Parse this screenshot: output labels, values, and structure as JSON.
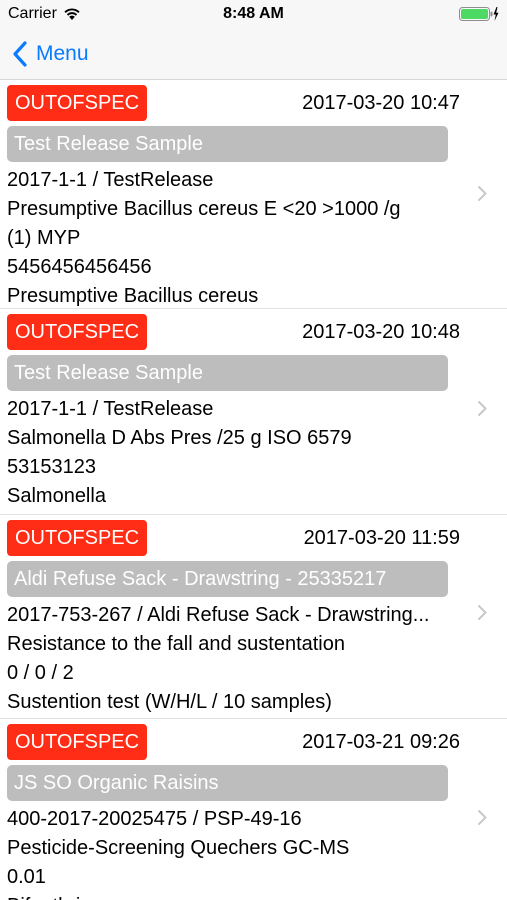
{
  "status_bar": {
    "carrier": "Carrier",
    "time": "8:48 AM"
  },
  "nav": {
    "back_label": "Menu"
  },
  "colors": {
    "badge": "#ff2d16",
    "sample_bar": "#bdbdbd",
    "tint": "#0a7aff",
    "battery": "#4cd964"
  },
  "rows": [
    {
      "status": "OUTOFSPEC",
      "date": "2017-03-20 10:47",
      "sample": "Test Release Sample",
      "lines": [
        "2017-1-1 / TestRelease",
        "Presumptive Bacillus cereus E <20 >1000 /g",
        "(1) MYP",
        "5456456456456",
        "Presumptive Bacillus cereus"
      ]
    },
    {
      "status": "OUTOFSPEC",
      "date": "2017-03-20 10:48",
      "sample": "Test Release Sample",
      "lines": [
        "2017-1-1 / TestRelease",
        "Salmonella D Abs Pres /25 g ISO 6579",
        "53153123",
        "Salmonella"
      ]
    },
    {
      "status": "OUTOFSPEC",
      "date": "2017-03-20 11:59",
      "sample": "Aldi Refuse Sack - Drawstring -  25335217",
      "lines": [
        "2017-753-267 / Aldi Refuse Sack - Drawstring...",
        "Resistance to the fall and sustentation",
        "0 / 0 / 2",
        "Sustention test (W/H/L / 10 samples)"
      ]
    },
    {
      "status": "OUTOFSPEC",
      "date": "2017-03-21 09:26",
      "sample": "JS SO Organic Raisins",
      "lines": [
        "400-2017-20025475 / PSP-49-16",
        "Pesticide-Screening Quechers GC-MS",
        "0.01",
        "Bifenthrin"
      ]
    }
  ]
}
